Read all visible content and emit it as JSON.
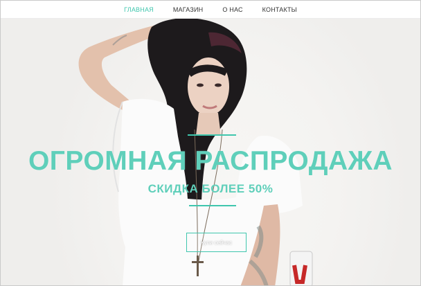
{
  "nav": {
    "items": [
      {
        "label": "ГЛАВНАЯ",
        "active": true
      },
      {
        "label": "МАГАЗИН",
        "active": false
      },
      {
        "label": "О НАС",
        "active": false
      },
      {
        "label": "КОНТАКТЫ",
        "active": false
      }
    ]
  },
  "hero": {
    "headline": "ОГРОМНАЯ РАСПРОДАЖА",
    "subheadline": "СКИДКА БОЛЕЕ 50%",
    "cta_label": "Купи сейчас"
  },
  "colors": {
    "accent": "#3fc6ad",
    "headline": "#5fcfba",
    "nav_text": "#333333",
    "nav_bg": "#ffffff"
  }
}
